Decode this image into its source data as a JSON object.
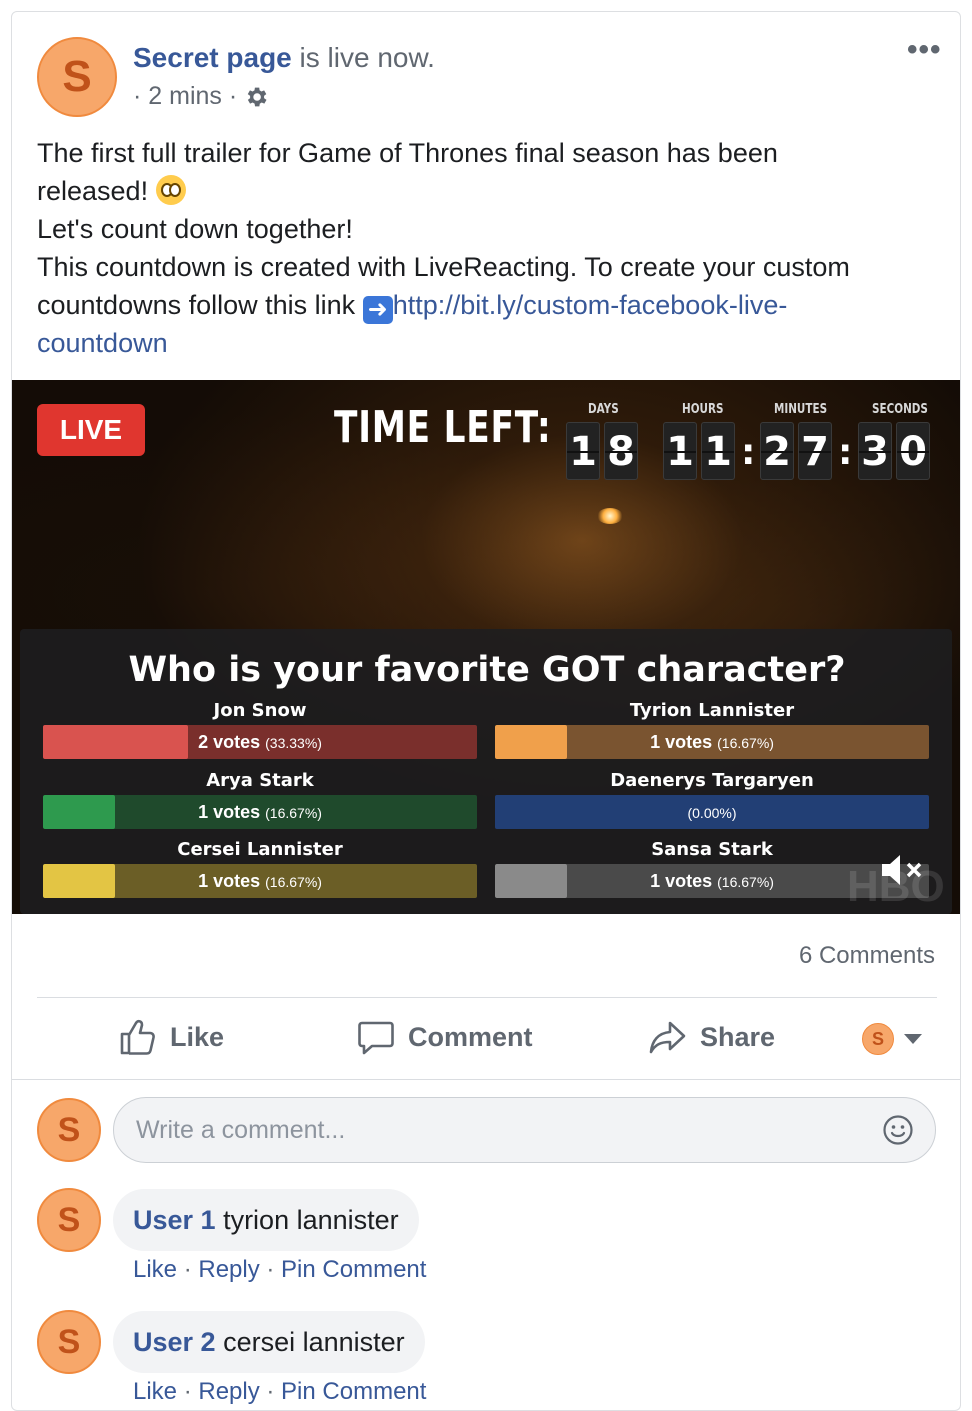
{
  "post": {
    "avatar_letter": "S",
    "page_name": "Secret page",
    "status_text": " is live now.",
    "time": "· 2 mins ·",
    "more_label": "•••",
    "text_line1": "The first full trailer for Game of Thrones final season has been",
    "text_line2": "released!",
    "text_line3": "Let's count down together!",
    "text_line4": "This countdown is created with LiveReacting. To create your custom",
    "text_line5": "countdowns follow this link",
    "link_text": "http://bit.ly/custom-facebook-live-",
    "link_text2": "countdown"
  },
  "video": {
    "live_label": "LIVE",
    "time_left_label": "TIME LEFT:",
    "countdown": {
      "labels": {
        "days": "DAYS",
        "hours": "HOURS",
        "minutes": "MINUTES",
        "seconds": "SECONDS"
      },
      "digits": {
        "d1": "1",
        "d2": "8",
        "h1": "1",
        "h2": "1",
        "m1": "2",
        "m2": "7",
        "s1": "3",
        "s2": "0"
      },
      "separator": ":"
    },
    "watermark": "HBO",
    "poll": {
      "question": "Who is your favorite GOT character?",
      "options": [
        {
          "name": "Jon Snow",
          "votes": "2 votes",
          "pct": "(33.33%)",
          "share": 0.3333,
          "color": "#d9534f",
          "track": "#7a2f2c"
        },
        {
          "name": "Tyrion Lannister",
          "votes": "1 votes",
          "pct": "(16.67%)",
          "share": 0.1667,
          "color": "#f0a04b",
          "track": "#7a5430"
        },
        {
          "name": "Arya Stark",
          "votes": "1 votes",
          "pct": "(16.67%)",
          "share": 0.1667,
          "color": "#2e9a4e",
          "track": "#1f4a2c"
        },
        {
          "name": "Daenerys Targaryen",
          "votes": "",
          "pct": "(0.00%)",
          "share": 0.0,
          "color": "#2a4d8f",
          "track": "#223f75"
        },
        {
          "name": "Cersei Lannister",
          "votes": "1 votes",
          "pct": "(16.67%)",
          "share": 0.1667,
          "color": "#e3c544",
          "track": "#6b5e26"
        },
        {
          "name": "Sansa Stark",
          "votes": "1 votes",
          "pct": "(16.67%)",
          "share": 0.1667,
          "color": "#8a8a8a",
          "track": "#4a4a4a"
        }
      ]
    }
  },
  "engagement": {
    "comments_count": "6 Comments",
    "like_label": "Like",
    "comment_label": "Comment",
    "share_label": "Share",
    "viewer_avatar": "S"
  },
  "comment_box": {
    "placeholder": "Write a comment..."
  },
  "comments": [
    {
      "avatar": "S",
      "user": "User 1",
      "text": " tyrion lannister",
      "like": "Like",
      "reply": "Reply",
      "pin": "Pin Comment",
      "sep": " · "
    },
    {
      "avatar": "S",
      "user": "User 2",
      "text": " cersei lannister",
      "like": "Like",
      "reply": "Reply",
      "pin": "Pin Comment",
      "sep": " · "
    }
  ]
}
